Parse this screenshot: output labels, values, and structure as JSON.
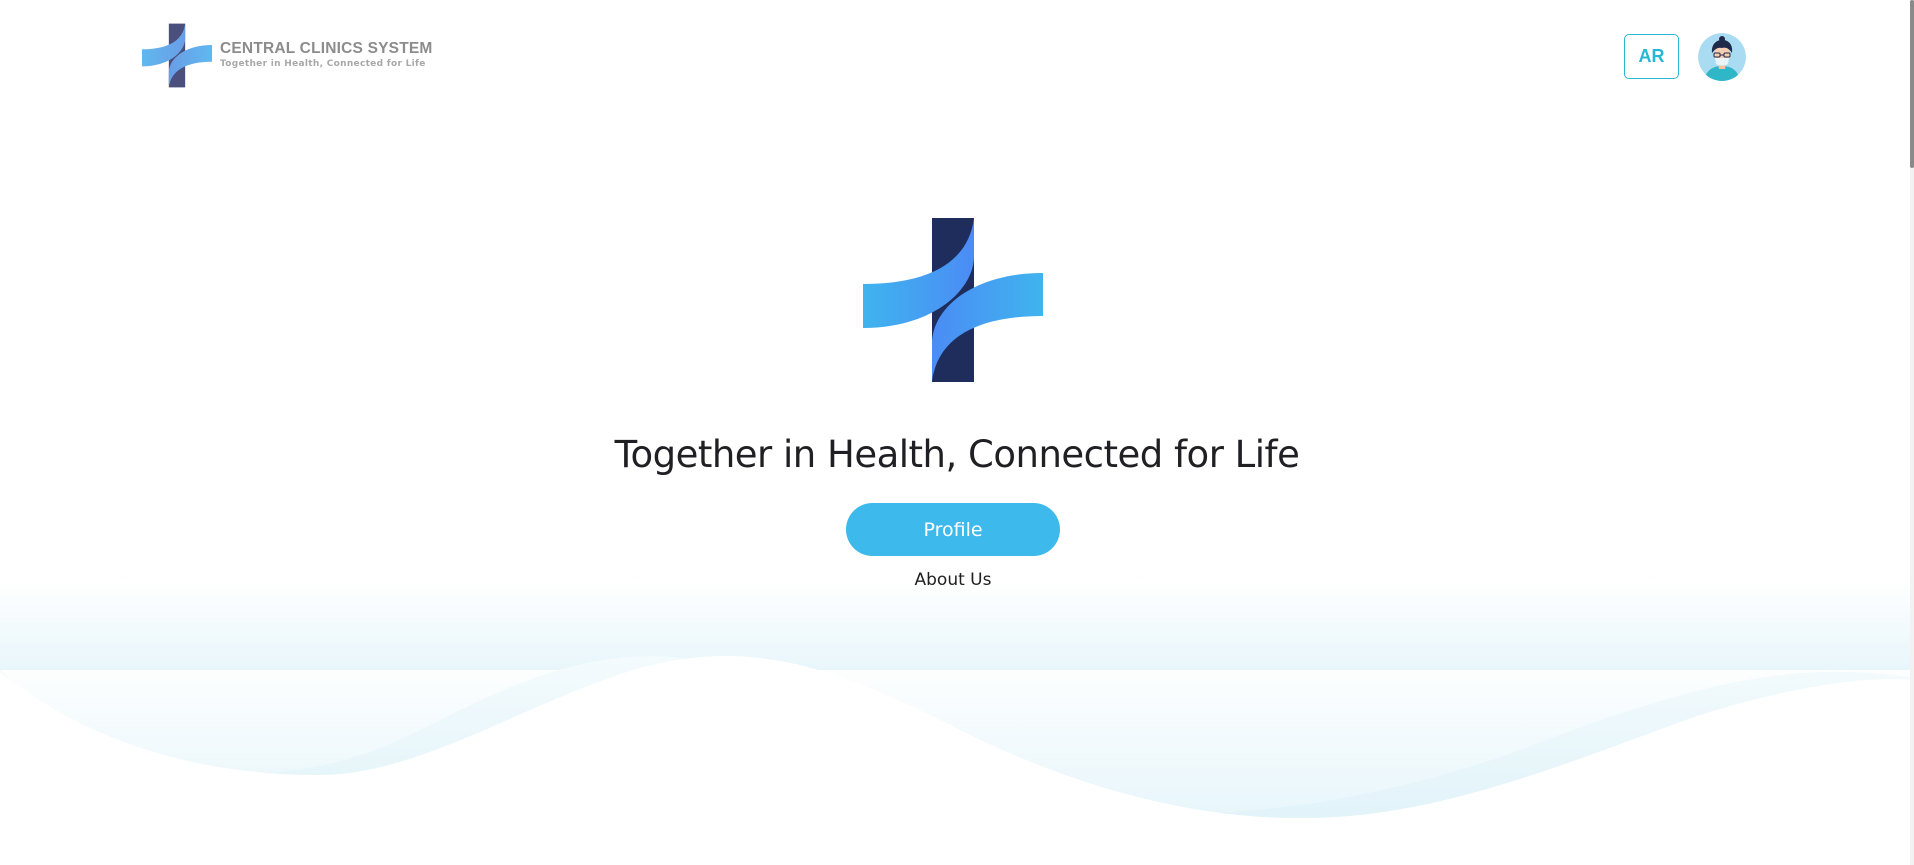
{
  "brand": {
    "name": "CENTRAL CLINICS SYSTEM",
    "tagline": "Together in Health, Connected for Life",
    "logo_icon": "medical-cross-ribbon-logo"
  },
  "header": {
    "language_button_label": "AR",
    "avatar_icon": "doctor-avatar-icon"
  },
  "hero": {
    "title": "Together in Health, Connected for Life",
    "profile_button_label": "Profile",
    "about_link_label": "About Us"
  },
  "colors": {
    "accent": "#3db9eb",
    "language_border": "#2bb6d2",
    "logo_navy": "#1f2d5c",
    "logo_light_blue": "#3fb4ee",
    "logo_mid_blue": "#4b8cf5",
    "wave_tint": "#e3f5fb"
  }
}
